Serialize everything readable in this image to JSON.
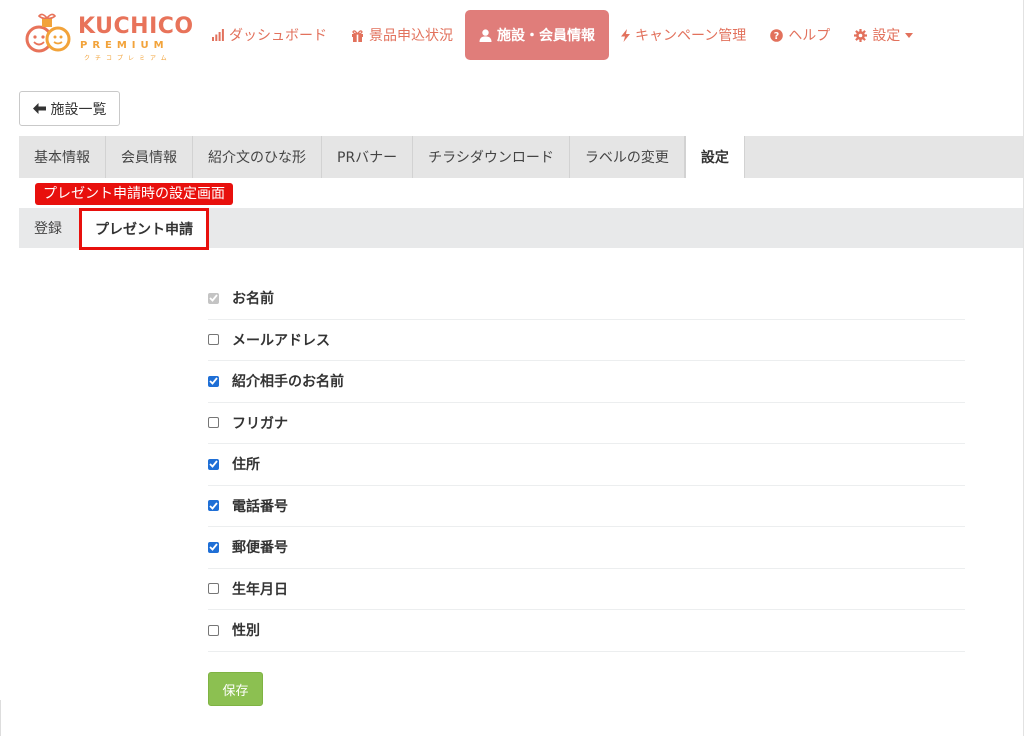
{
  "logo": {
    "main": "KUCHICO",
    "sub": "PREMIUM",
    "kana": "クチコプレミアム"
  },
  "nav": {
    "items": [
      {
        "label": "ダッシュボード",
        "icon": "bar-chart-icon"
      },
      {
        "label": "景品申込状況",
        "icon": "gift-icon"
      },
      {
        "label": "施設・会員情報",
        "icon": "user-icon",
        "active": true
      },
      {
        "label": "キャンペーン管理",
        "icon": "bolt-icon"
      },
      {
        "label": "ヘルプ",
        "icon": "question-circle-icon"
      },
      {
        "label": "設定",
        "icon": "gear-icon",
        "caret": true
      }
    ]
  },
  "back_button": {
    "label": "施設一覧",
    "icon": "arrow-left-icon"
  },
  "tabs": [
    {
      "label": "基本情報"
    },
    {
      "label": "会員情報"
    },
    {
      "label": "紹介文のひな形"
    },
    {
      "label": "PRバナー"
    },
    {
      "label": "チラシダウンロード"
    },
    {
      "label": "ラベルの変更"
    },
    {
      "label": "設定",
      "active": true
    }
  ],
  "annotation": {
    "label": "プレゼント申請時の設定画面"
  },
  "subtabs": [
    {
      "label": "登録"
    },
    {
      "label": "プレゼント申請",
      "active": true
    }
  ],
  "fields": [
    {
      "label": "お名前",
      "checked": true,
      "disabled": true
    },
    {
      "label": "メールアドレス",
      "checked": false
    },
    {
      "label": "紹介相手のお名前",
      "checked": true
    },
    {
      "label": "フリガナ",
      "checked": false
    },
    {
      "label": "住所",
      "checked": true
    },
    {
      "label": "電話番号",
      "checked": true
    },
    {
      "label": "郵便番号",
      "checked": true
    },
    {
      "label": "生年月日",
      "checked": false
    },
    {
      "label": "性別",
      "checked": false
    }
  ],
  "save_button": {
    "label": "保存"
  },
  "colors": {
    "brand": "#e2715c",
    "nav_active": "#e07d7a",
    "annotation": "#e8100d",
    "checkbox": "#1f6fd6",
    "save": "#8cc051"
  }
}
